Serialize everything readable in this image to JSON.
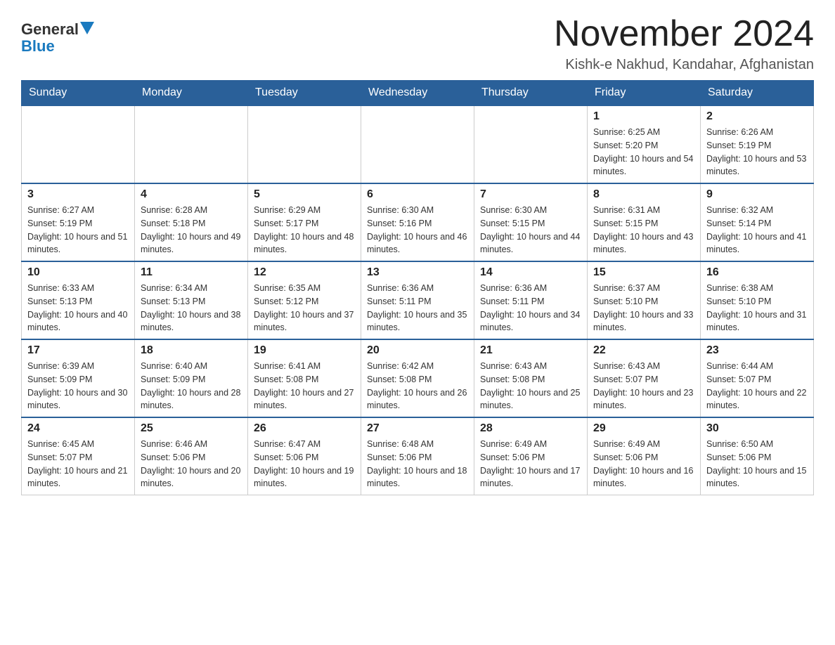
{
  "header": {
    "logo_general": "General",
    "logo_blue": "Blue",
    "month_title": "November 2024",
    "location": "Kishk-e Nakhud, Kandahar, Afghanistan"
  },
  "days_of_week": [
    "Sunday",
    "Monday",
    "Tuesday",
    "Wednesday",
    "Thursday",
    "Friday",
    "Saturday"
  ],
  "weeks": [
    [
      {
        "day": "",
        "sunrise": "",
        "sunset": "",
        "daylight": ""
      },
      {
        "day": "",
        "sunrise": "",
        "sunset": "",
        "daylight": ""
      },
      {
        "day": "",
        "sunrise": "",
        "sunset": "",
        "daylight": ""
      },
      {
        "day": "",
        "sunrise": "",
        "sunset": "",
        "daylight": ""
      },
      {
        "day": "",
        "sunrise": "",
        "sunset": "",
        "daylight": ""
      },
      {
        "day": "1",
        "sunrise": "Sunrise: 6:25 AM",
        "sunset": "Sunset: 5:20 PM",
        "daylight": "Daylight: 10 hours and 54 minutes."
      },
      {
        "day": "2",
        "sunrise": "Sunrise: 6:26 AM",
        "sunset": "Sunset: 5:19 PM",
        "daylight": "Daylight: 10 hours and 53 minutes."
      }
    ],
    [
      {
        "day": "3",
        "sunrise": "Sunrise: 6:27 AM",
        "sunset": "Sunset: 5:19 PM",
        "daylight": "Daylight: 10 hours and 51 minutes."
      },
      {
        "day": "4",
        "sunrise": "Sunrise: 6:28 AM",
        "sunset": "Sunset: 5:18 PM",
        "daylight": "Daylight: 10 hours and 49 minutes."
      },
      {
        "day": "5",
        "sunrise": "Sunrise: 6:29 AM",
        "sunset": "Sunset: 5:17 PM",
        "daylight": "Daylight: 10 hours and 48 minutes."
      },
      {
        "day": "6",
        "sunrise": "Sunrise: 6:30 AM",
        "sunset": "Sunset: 5:16 PM",
        "daylight": "Daylight: 10 hours and 46 minutes."
      },
      {
        "day": "7",
        "sunrise": "Sunrise: 6:30 AM",
        "sunset": "Sunset: 5:15 PM",
        "daylight": "Daylight: 10 hours and 44 minutes."
      },
      {
        "day": "8",
        "sunrise": "Sunrise: 6:31 AM",
        "sunset": "Sunset: 5:15 PM",
        "daylight": "Daylight: 10 hours and 43 minutes."
      },
      {
        "day": "9",
        "sunrise": "Sunrise: 6:32 AM",
        "sunset": "Sunset: 5:14 PM",
        "daylight": "Daylight: 10 hours and 41 minutes."
      }
    ],
    [
      {
        "day": "10",
        "sunrise": "Sunrise: 6:33 AM",
        "sunset": "Sunset: 5:13 PM",
        "daylight": "Daylight: 10 hours and 40 minutes."
      },
      {
        "day": "11",
        "sunrise": "Sunrise: 6:34 AM",
        "sunset": "Sunset: 5:13 PM",
        "daylight": "Daylight: 10 hours and 38 minutes."
      },
      {
        "day": "12",
        "sunrise": "Sunrise: 6:35 AM",
        "sunset": "Sunset: 5:12 PM",
        "daylight": "Daylight: 10 hours and 37 minutes."
      },
      {
        "day": "13",
        "sunrise": "Sunrise: 6:36 AM",
        "sunset": "Sunset: 5:11 PM",
        "daylight": "Daylight: 10 hours and 35 minutes."
      },
      {
        "day": "14",
        "sunrise": "Sunrise: 6:36 AM",
        "sunset": "Sunset: 5:11 PM",
        "daylight": "Daylight: 10 hours and 34 minutes."
      },
      {
        "day": "15",
        "sunrise": "Sunrise: 6:37 AM",
        "sunset": "Sunset: 5:10 PM",
        "daylight": "Daylight: 10 hours and 33 minutes."
      },
      {
        "day": "16",
        "sunrise": "Sunrise: 6:38 AM",
        "sunset": "Sunset: 5:10 PM",
        "daylight": "Daylight: 10 hours and 31 minutes."
      }
    ],
    [
      {
        "day": "17",
        "sunrise": "Sunrise: 6:39 AM",
        "sunset": "Sunset: 5:09 PM",
        "daylight": "Daylight: 10 hours and 30 minutes."
      },
      {
        "day": "18",
        "sunrise": "Sunrise: 6:40 AM",
        "sunset": "Sunset: 5:09 PM",
        "daylight": "Daylight: 10 hours and 28 minutes."
      },
      {
        "day": "19",
        "sunrise": "Sunrise: 6:41 AM",
        "sunset": "Sunset: 5:08 PM",
        "daylight": "Daylight: 10 hours and 27 minutes."
      },
      {
        "day": "20",
        "sunrise": "Sunrise: 6:42 AM",
        "sunset": "Sunset: 5:08 PM",
        "daylight": "Daylight: 10 hours and 26 minutes."
      },
      {
        "day": "21",
        "sunrise": "Sunrise: 6:43 AM",
        "sunset": "Sunset: 5:08 PM",
        "daylight": "Daylight: 10 hours and 25 minutes."
      },
      {
        "day": "22",
        "sunrise": "Sunrise: 6:43 AM",
        "sunset": "Sunset: 5:07 PM",
        "daylight": "Daylight: 10 hours and 23 minutes."
      },
      {
        "day": "23",
        "sunrise": "Sunrise: 6:44 AM",
        "sunset": "Sunset: 5:07 PM",
        "daylight": "Daylight: 10 hours and 22 minutes."
      }
    ],
    [
      {
        "day": "24",
        "sunrise": "Sunrise: 6:45 AM",
        "sunset": "Sunset: 5:07 PM",
        "daylight": "Daylight: 10 hours and 21 minutes."
      },
      {
        "day": "25",
        "sunrise": "Sunrise: 6:46 AM",
        "sunset": "Sunset: 5:06 PM",
        "daylight": "Daylight: 10 hours and 20 minutes."
      },
      {
        "day": "26",
        "sunrise": "Sunrise: 6:47 AM",
        "sunset": "Sunset: 5:06 PM",
        "daylight": "Daylight: 10 hours and 19 minutes."
      },
      {
        "day": "27",
        "sunrise": "Sunrise: 6:48 AM",
        "sunset": "Sunset: 5:06 PM",
        "daylight": "Daylight: 10 hours and 18 minutes."
      },
      {
        "day": "28",
        "sunrise": "Sunrise: 6:49 AM",
        "sunset": "Sunset: 5:06 PM",
        "daylight": "Daylight: 10 hours and 17 minutes."
      },
      {
        "day": "29",
        "sunrise": "Sunrise: 6:49 AM",
        "sunset": "Sunset: 5:06 PM",
        "daylight": "Daylight: 10 hours and 16 minutes."
      },
      {
        "day": "30",
        "sunrise": "Sunrise: 6:50 AM",
        "sunset": "Sunset: 5:06 PM",
        "daylight": "Daylight: 10 hours and 15 minutes."
      }
    ]
  ]
}
